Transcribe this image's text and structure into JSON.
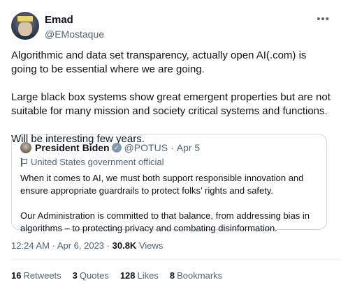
{
  "author": {
    "name": "Emad",
    "handle": "@EMostaque"
  },
  "more_label": "•••",
  "tweet": {
    "paragraphs": [
      "Algorithmic and data set transparency, actually open AI(.com) is going to be essential where we are going.",
      "Large black box systems show great emergent properties but are not suitable for many mission and society critical systems and functions.",
      "Will be interesting few years."
    ]
  },
  "quote": {
    "name": "President Biden",
    "verified_icon": "✓",
    "handle": "@POTUS",
    "separator": "·",
    "date": "Apr 5",
    "label": "United States government official",
    "paragraphs": [
      "When it comes to AI, we must both support responsible innovation and ensure appropriate guardrails to protect folks’ rights and safety.",
      "Our Administration is committed to that balance, from addressing bias in algorithms – to protecting privacy and combating disinformation."
    ]
  },
  "meta": {
    "time": "12:24 AM",
    "sep": "·",
    "date": "Apr 6, 2023",
    "sep2": "·",
    "views_count": "30.8K",
    "views_label": "Views"
  },
  "stats": [
    {
      "count": "16",
      "label": "Retweets"
    },
    {
      "count": "3",
      "label": "Quotes"
    },
    {
      "count": "128",
      "label": "Likes"
    },
    {
      "count": "8",
      "label": "Bookmarks"
    }
  ],
  "colors": {
    "text": "#0f1419",
    "secondary": "#536471",
    "border": "#cfd9de",
    "verified_government": "#829aab"
  }
}
